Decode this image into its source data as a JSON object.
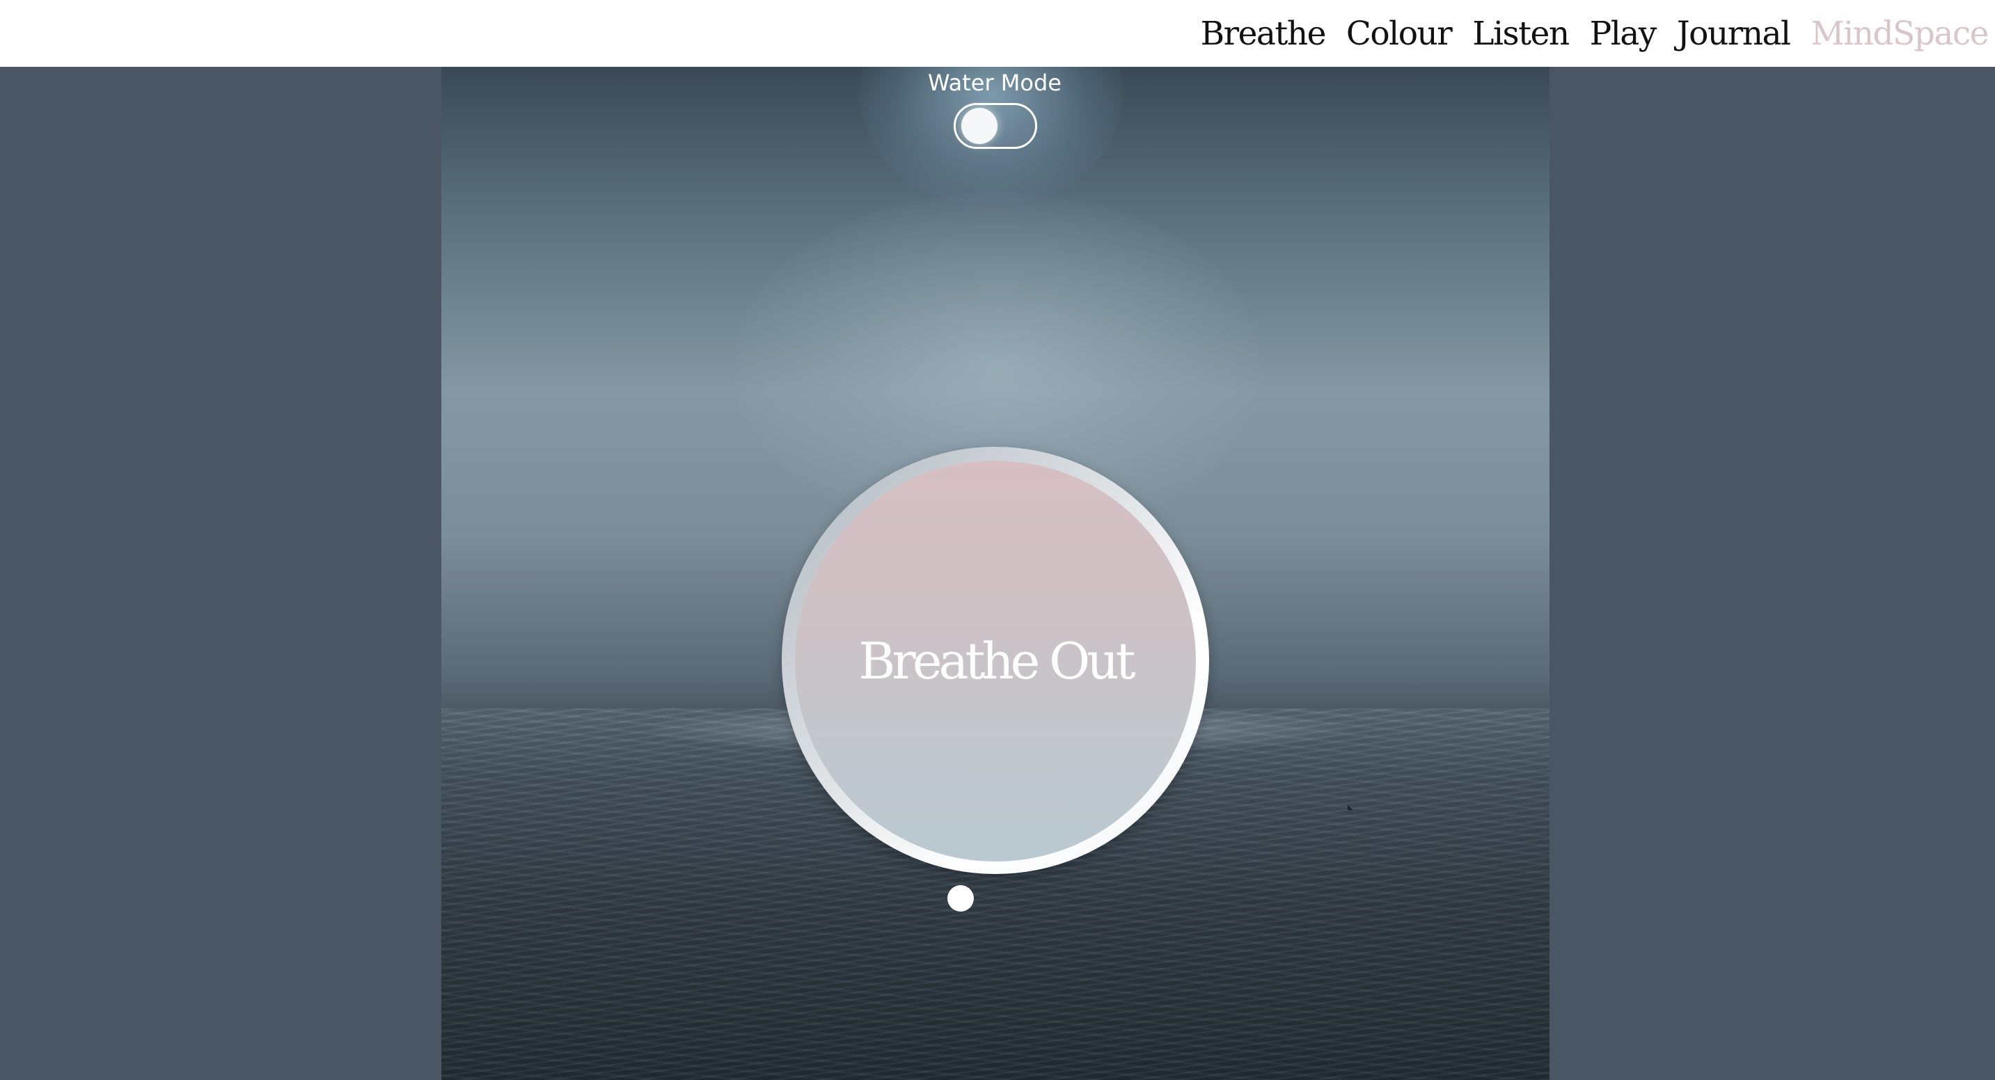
{
  "nav": {
    "items": [
      {
        "label": "Breathe"
      },
      {
        "label": "Colour"
      },
      {
        "label": "Listen"
      },
      {
        "label": "Play"
      },
      {
        "label": "Journal"
      }
    ],
    "brand": "MindSpace"
  },
  "water_mode": {
    "label": "Water Mode",
    "enabled": false
  },
  "breathing": {
    "instruction": "Breathe Out"
  },
  "colors": {
    "page_background": "#4a5663",
    "brand": "#d9c6c9",
    "circle_top": "#d7bfc2",
    "circle_bottom": "#b9c8d1"
  }
}
